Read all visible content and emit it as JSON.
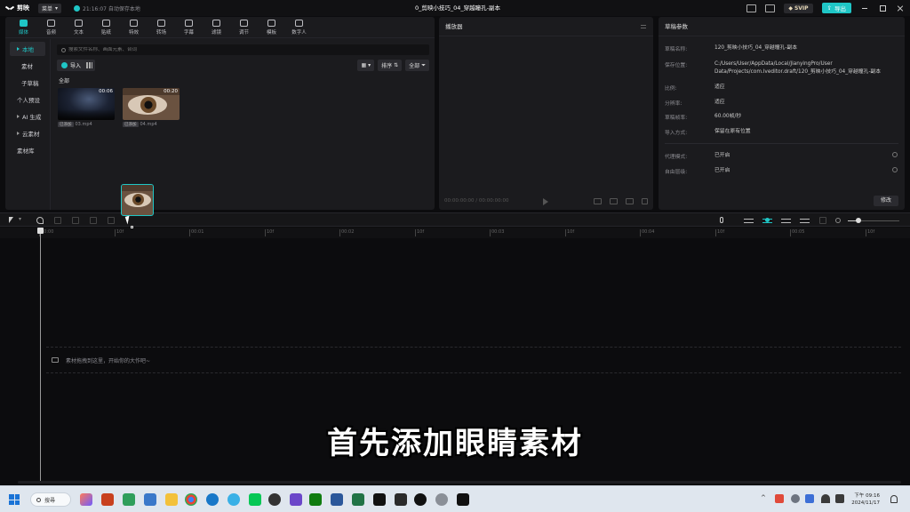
{
  "titlebar": {
    "app_name": "剪映",
    "menu_label": "菜单",
    "autosave_text": "21:16:07 自动保存本地",
    "project_title": "0_剪映小技巧_04_穿越瞳孔-副本",
    "svip_label": "SVIP",
    "export_label": "导出"
  },
  "tooltabs": [
    {
      "label": "媒体",
      "icon": "media-icon"
    },
    {
      "label": "音频",
      "icon": "audio-icon"
    },
    {
      "label": "文本",
      "icon": "text-icon"
    },
    {
      "label": "贴纸",
      "icon": "sticker-icon"
    },
    {
      "label": "特效",
      "icon": "effects-icon"
    },
    {
      "label": "转场",
      "icon": "transition-icon"
    },
    {
      "label": "字幕",
      "icon": "caption-icon"
    },
    {
      "label": "滤镜",
      "icon": "filter-icon"
    },
    {
      "label": "调节",
      "icon": "adjust-icon"
    },
    {
      "label": "模板",
      "icon": "template-icon"
    },
    {
      "label": "数字人",
      "icon": "avatar-icon"
    }
  ],
  "sidebar": {
    "items": [
      {
        "label": "本地"
      },
      {
        "label": "素材"
      },
      {
        "label": "子草稿"
      },
      {
        "label": "个人预设"
      },
      {
        "label": "AI 生成"
      },
      {
        "label": "云素材"
      },
      {
        "label": "素材库"
      }
    ]
  },
  "media": {
    "search_placeholder": "搜索文件名称、画面元素、台词",
    "import_label": "导入",
    "sort_label": "排序",
    "filter_label": "全部",
    "section_label": "全部",
    "clips": [
      {
        "duration": "00:06",
        "tag": "已添加",
        "name": "03.mp4"
      },
      {
        "duration": "00:20",
        "tag": "已添加",
        "name": "04.mp4"
      }
    ]
  },
  "player": {
    "title": "播放器",
    "time_current": "00:00:00:00",
    "time_total": "00:00:00:00"
  },
  "props": {
    "title": "草稿参数",
    "rows": [
      {
        "key": "草稿名称:",
        "value": "120_剪映小技巧_04_穿越瞳孔-副本"
      },
      {
        "key": "保存位置:",
        "value": "C:/Users/User/AppData/Local/JianyingPro/User Data/Projects/com.lveditor.draft/120_剪映小技巧_04_穿越瞳孔-副本"
      },
      {
        "key": "比例:",
        "value": "适应"
      },
      {
        "key": "分辨率:",
        "value": "适应"
      },
      {
        "key": "草稿帧率:",
        "value": "60.00帧/秒"
      },
      {
        "key": "导入方式:",
        "value": "保留在原有位置"
      },
      {
        "key": "代理模式:",
        "value": "已开启"
      },
      {
        "key": "自由层级:",
        "value": "已开启"
      }
    ],
    "modify_label": "修改"
  },
  "timeline": {
    "ruler_ticks": [
      "00:00",
      "10f",
      "00:01",
      "10f",
      "00:02",
      "10f",
      "00:03",
      "10f",
      "00:04",
      "10f",
      "00:05",
      "10f"
    ],
    "drop_hint": "素材拖拽到这里，开始你的大作吧~"
  },
  "subtitle": "首先添加眼睛素材",
  "taskbar": {
    "search_label": "搜尋",
    "time": "下午 09:16",
    "date": "2024/11/17"
  }
}
